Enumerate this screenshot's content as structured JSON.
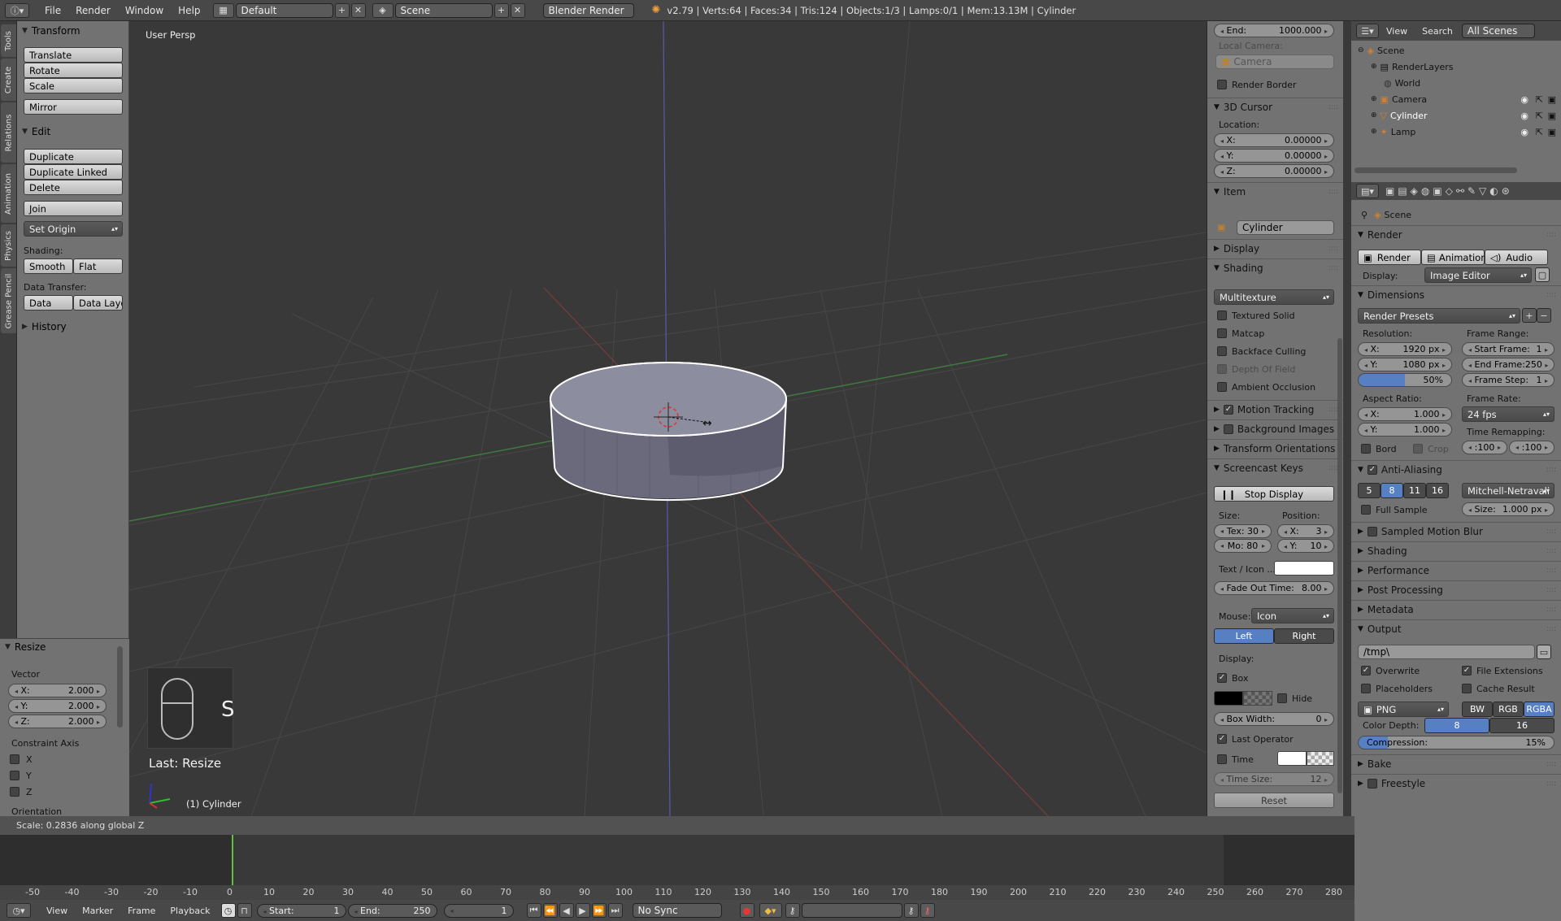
{
  "topbar": {
    "menus": [
      "File",
      "Render",
      "Window",
      "Help"
    ],
    "layout": "Default",
    "scene": "Scene",
    "engine": "Blender Render",
    "stats": "v2.79 | Verts:64 | Faces:34 | Tris:124 | Objects:1/3 | Lamps:0/1 | Mem:13.13M | Cylinder"
  },
  "side_tabs": [
    "Tools",
    "Create",
    "Relations",
    "Animation",
    "Physics",
    "Grease Pencil"
  ],
  "toolshelf": {
    "transform_title": "Transform",
    "transform_buttons": [
      "Translate",
      "Rotate",
      "Scale",
      "Mirror"
    ],
    "edit_title": "Edit",
    "edit_buttons": [
      "Duplicate",
      "Duplicate Linked",
      "Delete",
      "Join"
    ],
    "set_origin": "Set Origin",
    "shading_label": "Shading:",
    "smooth": "Smooth",
    "flat": "Flat",
    "data_transfer_label": "Data Transfer:",
    "data": "Data",
    "data_layo": "Data Layo",
    "history_title": "History"
  },
  "resize_panel": {
    "title": "Resize",
    "vector_label": "Vector",
    "x": "X:",
    "x_val": "2.000",
    "y": "Y:",
    "y_val": "2.000",
    "z": "Z:",
    "z_val": "2.000",
    "constraint_label": "Constraint Axis",
    "cx": "X",
    "cy": "Y",
    "cz": "Z",
    "orientation": "Orientation"
  },
  "viewport": {
    "label": "User Persp",
    "key_letter": "S",
    "last_op": "Last: Resize",
    "object_label": "(1) Cylinder"
  },
  "npanel": {
    "end_label": "End:",
    "end_val": "1000.000",
    "local_camera": "Local Camera:",
    "camera_field": "Camera",
    "render_border": "Render Border",
    "cursor_title": "3D Cursor",
    "location": "Location:",
    "cx": "X:",
    "cx_val": "0.00000",
    "cy": "Y:",
    "cy_val": "0.00000",
    "cz": "Z:",
    "cz_val": "0.00000",
    "item_title": "Item",
    "item_name": "Cylinder",
    "display_title": "Display",
    "shading_title": "Shading",
    "shading_mode": "Multitexture",
    "shading_opts": [
      "Textured Solid",
      "Matcap",
      "Backface Culling",
      "Depth Of Field",
      "Ambient Occlusion"
    ],
    "motion_tracking": "Motion Tracking",
    "background_images": "Background Images",
    "transform_orientations": "Transform Orientations",
    "screencast_title": "Screencast Keys",
    "stop_display": "Stop Display",
    "size_label": "Size:",
    "position_label": "Position:",
    "tex": "Tex: 30",
    "mo": "Mo: 80",
    "px": "X:",
    "px_val": "3",
    "py": "Y:",
    "py_val": "10",
    "text_icon": "Text / Icon ...",
    "fade_out": "Fade Out Time:",
    "fade_val": "8.00",
    "mouse_label": "Mouse:",
    "mouse_val": "Icon",
    "left": "Left",
    "right": "Right",
    "display_label": "Display:",
    "box": "Box",
    "hide": "Hide",
    "box_width": "Box Width:",
    "box_width_val": "0",
    "last_operator": "Last Operator",
    "time": "Time",
    "time_size": "Time Size:",
    "time_size_val": "12",
    "reset": "Reset"
  },
  "outliner": {
    "view": "View",
    "search": "Search",
    "scenes": "All Scenes",
    "items": [
      "Scene",
      "RenderLayers",
      "World",
      "Camera",
      "Cylinder",
      "Lamp"
    ]
  },
  "props": {
    "scene": "Scene",
    "render_title": "Render",
    "render_btn": "Render",
    "animation_btn": "Animation",
    "audio_btn": "Audio",
    "display_label": "Display:",
    "display_val": "Image Editor",
    "dimensions_title": "Dimensions",
    "render_presets": "Render Presets",
    "resolution": "Resolution:",
    "res_x": "X:",
    "res_x_val": "1920 px",
    "res_y": "Y:",
    "res_y_val": "1080 px",
    "res_pct": "50%",
    "frame_range": "Frame Range:",
    "start_frame": "Start Frame:",
    "start_frame_val": "1",
    "end_frame": "End Frame:",
    "end_frame_val": "250",
    "frame_step": "Frame Step:",
    "frame_step_val": "1",
    "aspect": "Aspect Ratio:",
    "asp_x": "X:",
    "asp_x_val": "1.000",
    "asp_y": "Y:",
    "asp_y_val": "1.000",
    "frame_rate": "Frame Rate:",
    "fps": "24 fps",
    "time_remap": "Time Remapping:",
    "remap_old": ":100",
    "remap_new": ":100",
    "bord": "Bord",
    "crop": "Crop",
    "aa_title": "Anti-Aliasing",
    "aa_samples": [
      "5",
      "8",
      "11",
      "16"
    ],
    "aa_filter": "Mitchell-Netravali",
    "full_sample": "Full Sample",
    "aa_size": "Size:",
    "aa_size_val": "1.000 px",
    "sections": [
      "Sampled Motion Blur",
      "Shading",
      "Performance",
      "Post Processing",
      "Metadata"
    ],
    "output_title": "Output",
    "output_path": "/tmp\\",
    "overwrite": "Overwrite",
    "file_ext": "File Extensions",
    "placeholders": "Placeholders",
    "cache_result": "Cache Result",
    "format": "PNG",
    "bw": "BW",
    "rgb": "RGB",
    "rgba": "RGBA",
    "color_depth": "Color Depth:",
    "depth_8": "8",
    "depth_16": "16",
    "compression": "Compression:",
    "compression_val": "15%",
    "bake": "Bake",
    "freestyle": "Freestyle"
  },
  "status": "Scale: 0.2836 along global Z",
  "timeline": {
    "ruler": [
      "-50",
      "-40",
      "-30",
      "-20",
      "-10",
      "0",
      "10",
      "20",
      "30",
      "40",
      "50",
      "60",
      "70",
      "80",
      "90",
      "100",
      "110",
      "120",
      "130",
      "140",
      "150",
      "160",
      "170",
      "180",
      "190",
      "200",
      "210",
      "220",
      "230",
      "240",
      "250",
      "260",
      "270",
      "280"
    ],
    "menus": [
      "View",
      "Marker",
      "Frame",
      "Playback"
    ],
    "start": "Start:",
    "start_val": "1",
    "end": "End:",
    "end_val": "250",
    "current": "1",
    "sync": "No Sync"
  },
  "colors": {
    "accent": "#5680c2",
    "bg": "#393939",
    "panel": "#727272"
  }
}
